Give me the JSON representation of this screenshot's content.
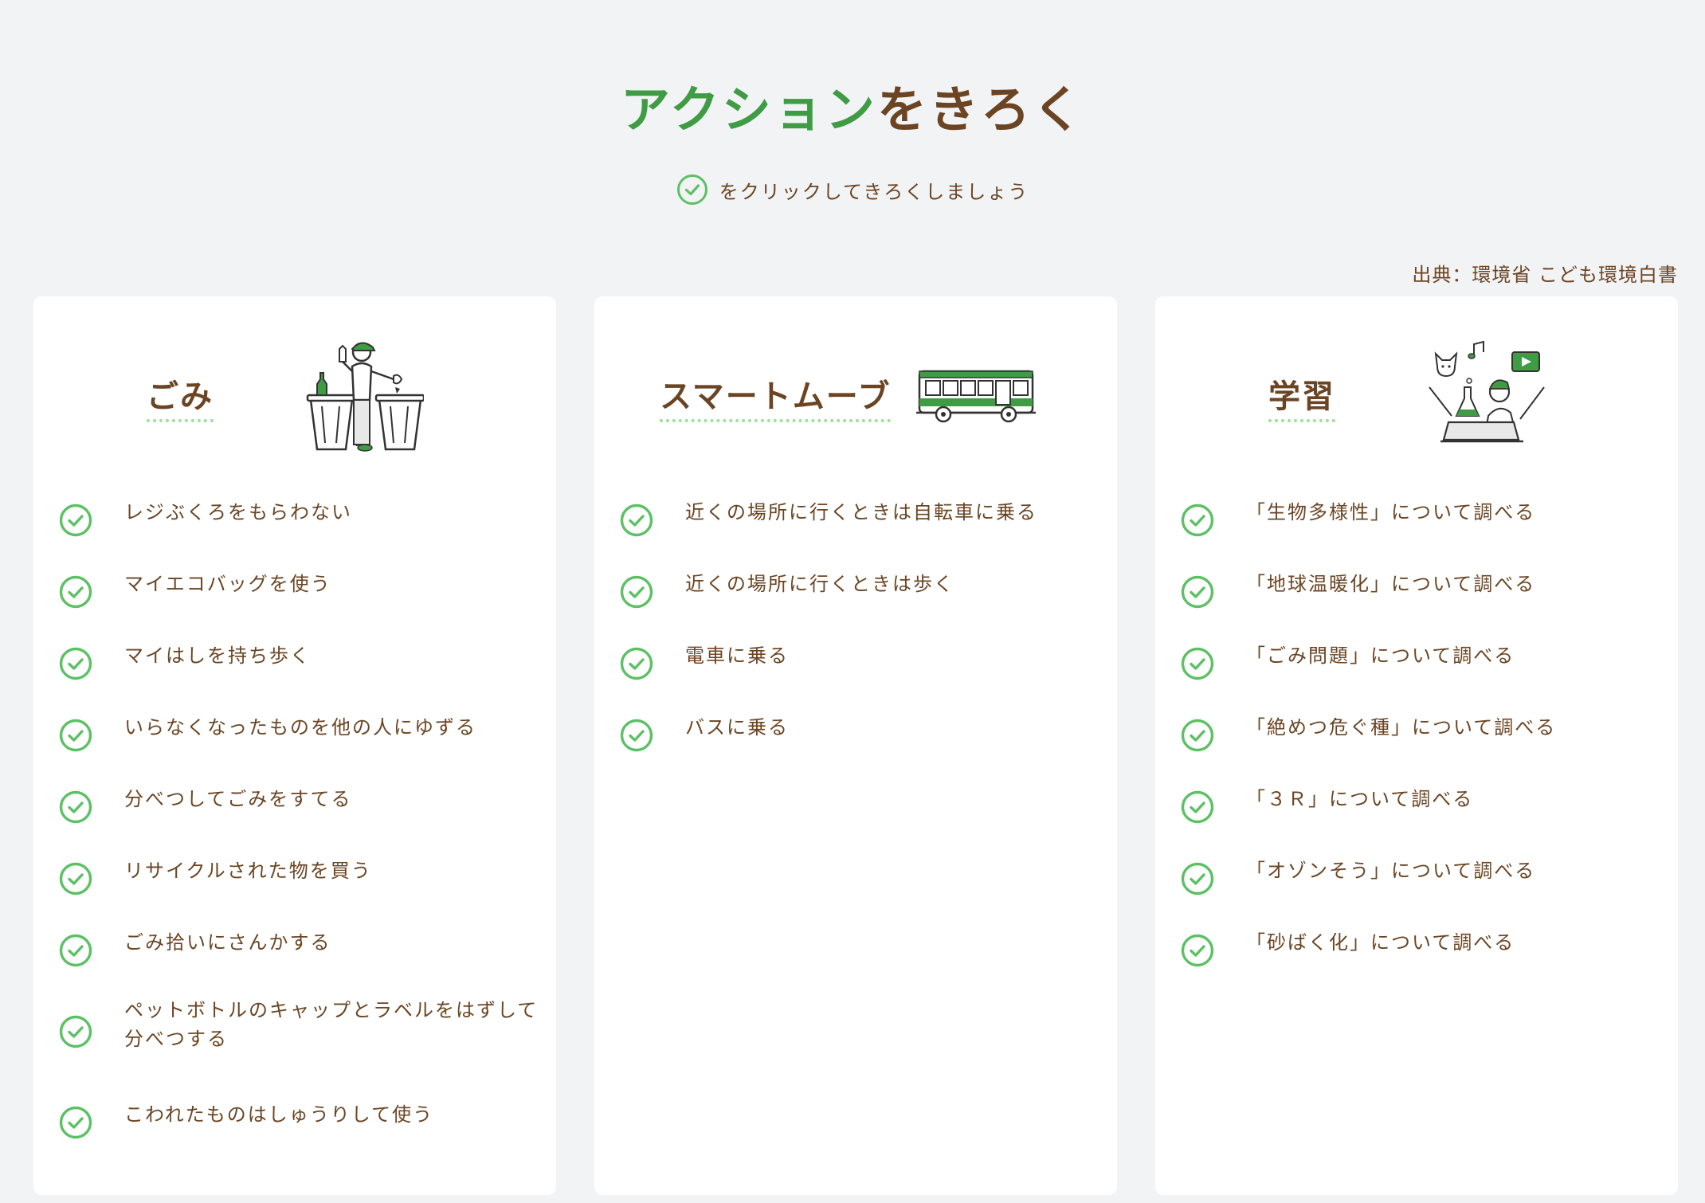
{
  "header": {
    "title_green": "アクション",
    "title_brown": "をきろく",
    "hint": "をクリックしてきろくしましょう",
    "source": "出典：環境省 こども環境白書"
  },
  "colors": {
    "background": "#f2f3f5",
    "brown": "#6b4523",
    "green": "#3f9c45",
    "check_green": "#5cc065",
    "underline": "#9be09b"
  },
  "categories": [
    {
      "title": "ごみ",
      "icon": "trash-cans-illustration",
      "items": [
        "レジぶくろをもらわない",
        "マイエコバッグを使う",
        "マイはしを持ち歩く",
        "いらなくなったものを他の人にゆずる",
        "分べつしてごみをすてる",
        "リサイクルされた物を買う",
        "ごみ拾いにさんかする",
        "ペットボトルのキャップとラベルをはずして分べつする",
        "こわれたものはしゅうりして使う"
      ]
    },
    {
      "title": "スマートムーブ",
      "icon": "bus-illustration",
      "items": [
        "近くの場所に行くときは自転車に乗る",
        "近くの場所に行くときは歩く",
        "電車に乗る",
        "バスに乗る"
      ]
    },
    {
      "title": "学習",
      "icon": "study-laptop-illustration",
      "items": [
        "「生物多様性」について調べる",
        "「地球温暖化」について調べる",
        "「ごみ問題」について調べる",
        "「絶めつ危ぐ種」について調べる",
        "「３Ｒ」について調べる",
        "「オゾンそう」について調べる",
        "「砂ばく化」について調べる"
      ]
    }
  ]
}
